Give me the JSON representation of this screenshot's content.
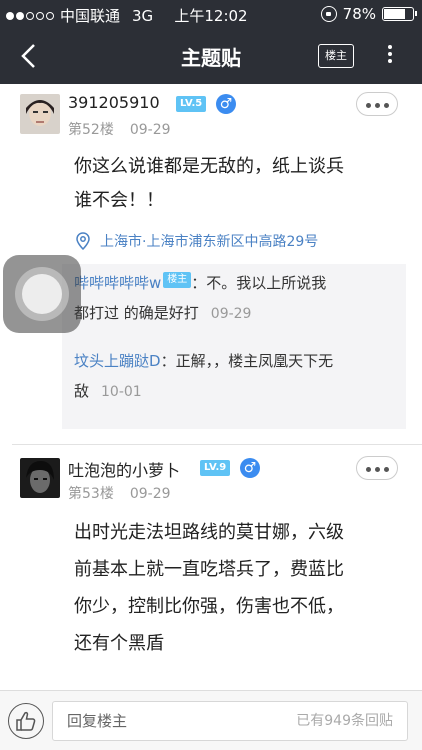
{
  "status_bar": {
    "carrier": "中国联通",
    "network": "3G",
    "time": "上午12:02",
    "battery": "78%",
    "battery_level": 0.78
  },
  "nav": {
    "title": "主题贴",
    "op_only_label": "楼主"
  },
  "posts": [
    {
      "username": "391205910",
      "level": "LV.5",
      "gender": "♂",
      "floor": "第52楼",
      "date": "09-29",
      "body_lines": [
        "你这么说谁都是无敌的，纸上谈兵",
        "谁不会！！"
      ],
      "location": "上海市·上海市浦东新区中高路29号",
      "replies": [
        {
          "name": "哔哔哔哔哔w",
          "op_tag": "楼主",
          "line1": "：不。我以上所说我",
          "line2": "都打过 的确是好打",
          "date": "09-29"
        },
        {
          "name": "坟头上蹦跶D",
          "line1": "：正解，，楼主凤凰天下无",
          "line2": "敌",
          "date": "10-01"
        }
      ]
    },
    {
      "username": "吐泡泡的小萝卜",
      "level": "LV.9",
      "gender": "♂",
      "floor": "第53楼",
      "date": "09-29",
      "body_lines": [
        "出时光走法坦路线的莫甘娜，六级",
        "前基本上就一直吃塔兵了，费蓝比",
        "你少，控制比你强，伤害也不低，",
        "还有个黑盾"
      ]
    }
  ],
  "bottom_bar": {
    "reply_placeholder": "回复楼主",
    "reply_count": "已有949条回贴"
  }
}
